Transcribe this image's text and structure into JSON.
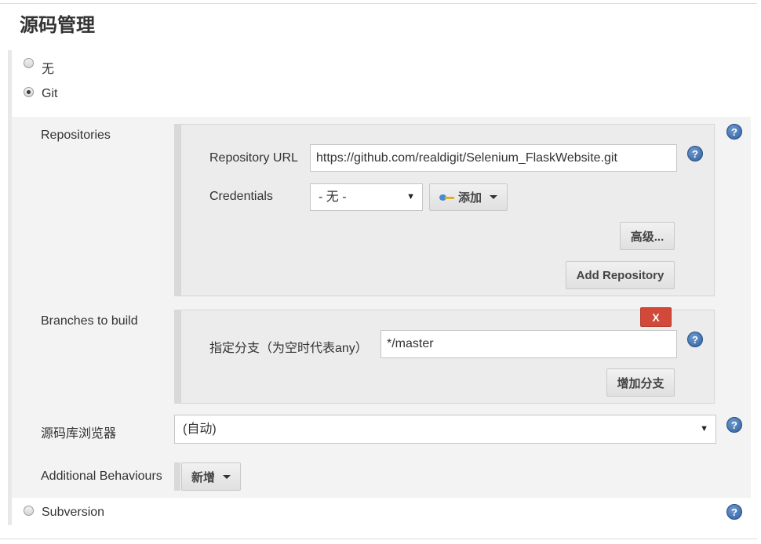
{
  "section_title": "源码管理",
  "scm_options": {
    "none_label": "无",
    "git_label": "Git",
    "svn_label": "Subversion",
    "selected": "Git"
  },
  "repositories": {
    "label": "Repositories",
    "url_label": "Repository URL",
    "url_value": "https://github.com/realdigit/Selenium_FlaskWebsite.git",
    "credentials_label": "Credentials",
    "credentials_value": "- 无 -",
    "add_credentials_label": "添加",
    "advanced_label": "高级...",
    "add_repository_label": "Add Repository"
  },
  "branches": {
    "label": "Branches to build",
    "delete_label": "X",
    "specifier_label": "指定分支（为空时代表any）",
    "specifier_value": "*/master",
    "add_branch_label": "增加分支"
  },
  "browser": {
    "label": "源码库浏览器",
    "value": "(自动)"
  },
  "behaviours": {
    "label": "Additional Behaviours",
    "add_label": "新增"
  },
  "help_glyph": "?",
  "icons": {
    "help": "help-circle-icon",
    "credentials": "key-icon",
    "dropdown": "caret-down-icon"
  },
  "colors": {
    "help_blue": "#2f5f9e",
    "delete_red": "#d24939",
    "panel_bg": "#ececec"
  }
}
